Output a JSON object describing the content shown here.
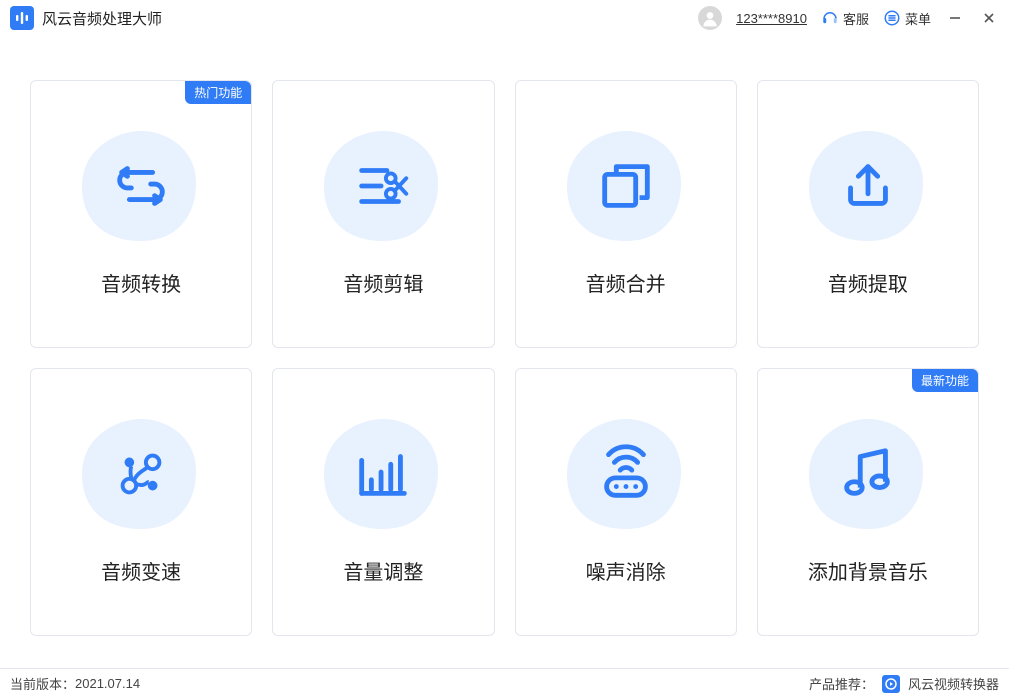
{
  "app": {
    "title": "风云音频处理大师"
  },
  "titlebar": {
    "user_id": "123****8910",
    "support_label": "客服",
    "menu_label": "菜单"
  },
  "badges": {
    "hot": "热门功能",
    "new": "最新功能"
  },
  "cards": [
    {
      "label": "音频转换"
    },
    {
      "label": "音频剪辑"
    },
    {
      "label": "音频合并"
    },
    {
      "label": "音频提取"
    },
    {
      "label": "音频变速"
    },
    {
      "label": "音量调整"
    },
    {
      "label": "噪声消除"
    },
    {
      "label": "添加背景音乐"
    }
  ],
  "footer": {
    "version_prefix": "当前版本：",
    "version": "2021.07.14",
    "promo_prefix": "产品推荐：",
    "promo_name": "风云视频转换器"
  },
  "colors": {
    "accent": "#2f7cf6",
    "blob": "#e8f1fe",
    "text": "#222222",
    "border": "#e3e6ec"
  }
}
